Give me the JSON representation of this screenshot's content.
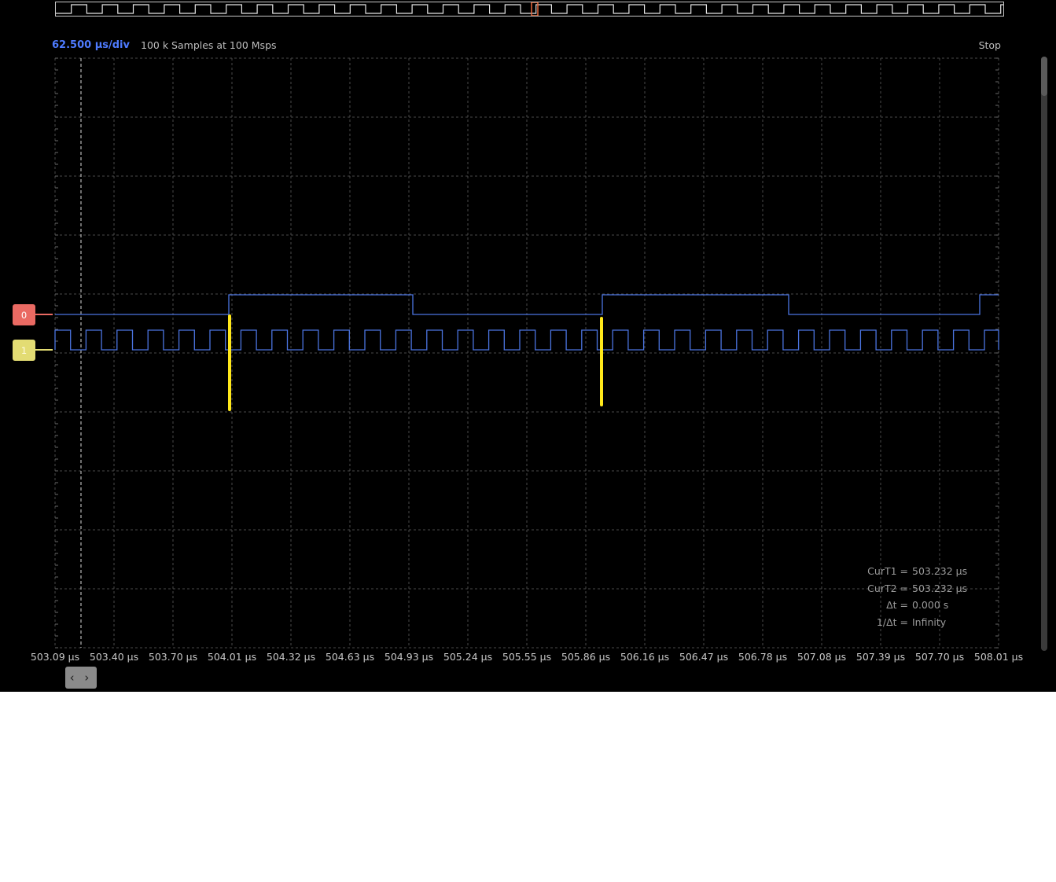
{
  "header": {
    "timebase": "62.500 µs/div",
    "samples": "100 k Samples at 100 Msps",
    "run_state": "Stop"
  },
  "x_axis_labels": [
    "503.09 µs",
    "503.40 µs",
    "503.70 µs",
    "504.01 µs",
    "504.32 µs",
    "504.63 µs",
    "504.93 µs",
    "505.24 µs",
    "505.55 µs",
    "505.86 µs",
    "506.16 µs",
    "506.47 µs",
    "506.78 µs",
    "507.08 µs",
    "507.39 µs",
    "507.70 µs",
    "508.01 µs"
  ],
  "channels": [
    {
      "label": "0",
      "color": "#ea6a63"
    },
    {
      "label": "1",
      "color": "#e3dc73"
    }
  ],
  "cursor_readout": {
    "curT1_label": "CurT1 =",
    "curT1_value": "503.232 µs",
    "curT2_label": "CurT2 =",
    "curT2_value": "503.232 µs",
    "dt_label": "Δt =",
    "dt_value": "0.000 s",
    "inv_dt_label": "1/Δt =",
    "inv_dt_value": "Infinity"
  },
  "colors": {
    "trace": "#4b74e0",
    "grid": "#4a4a4a",
    "cursor_line": "#dcdcdc",
    "markers": "#ffe81a",
    "overview_marker": "#e8673a",
    "timebase": "#4e7bff"
  },
  "pan_button": {
    "icon": "chevrons-left-right-icon",
    "glyph": "‹ ›"
  }
}
